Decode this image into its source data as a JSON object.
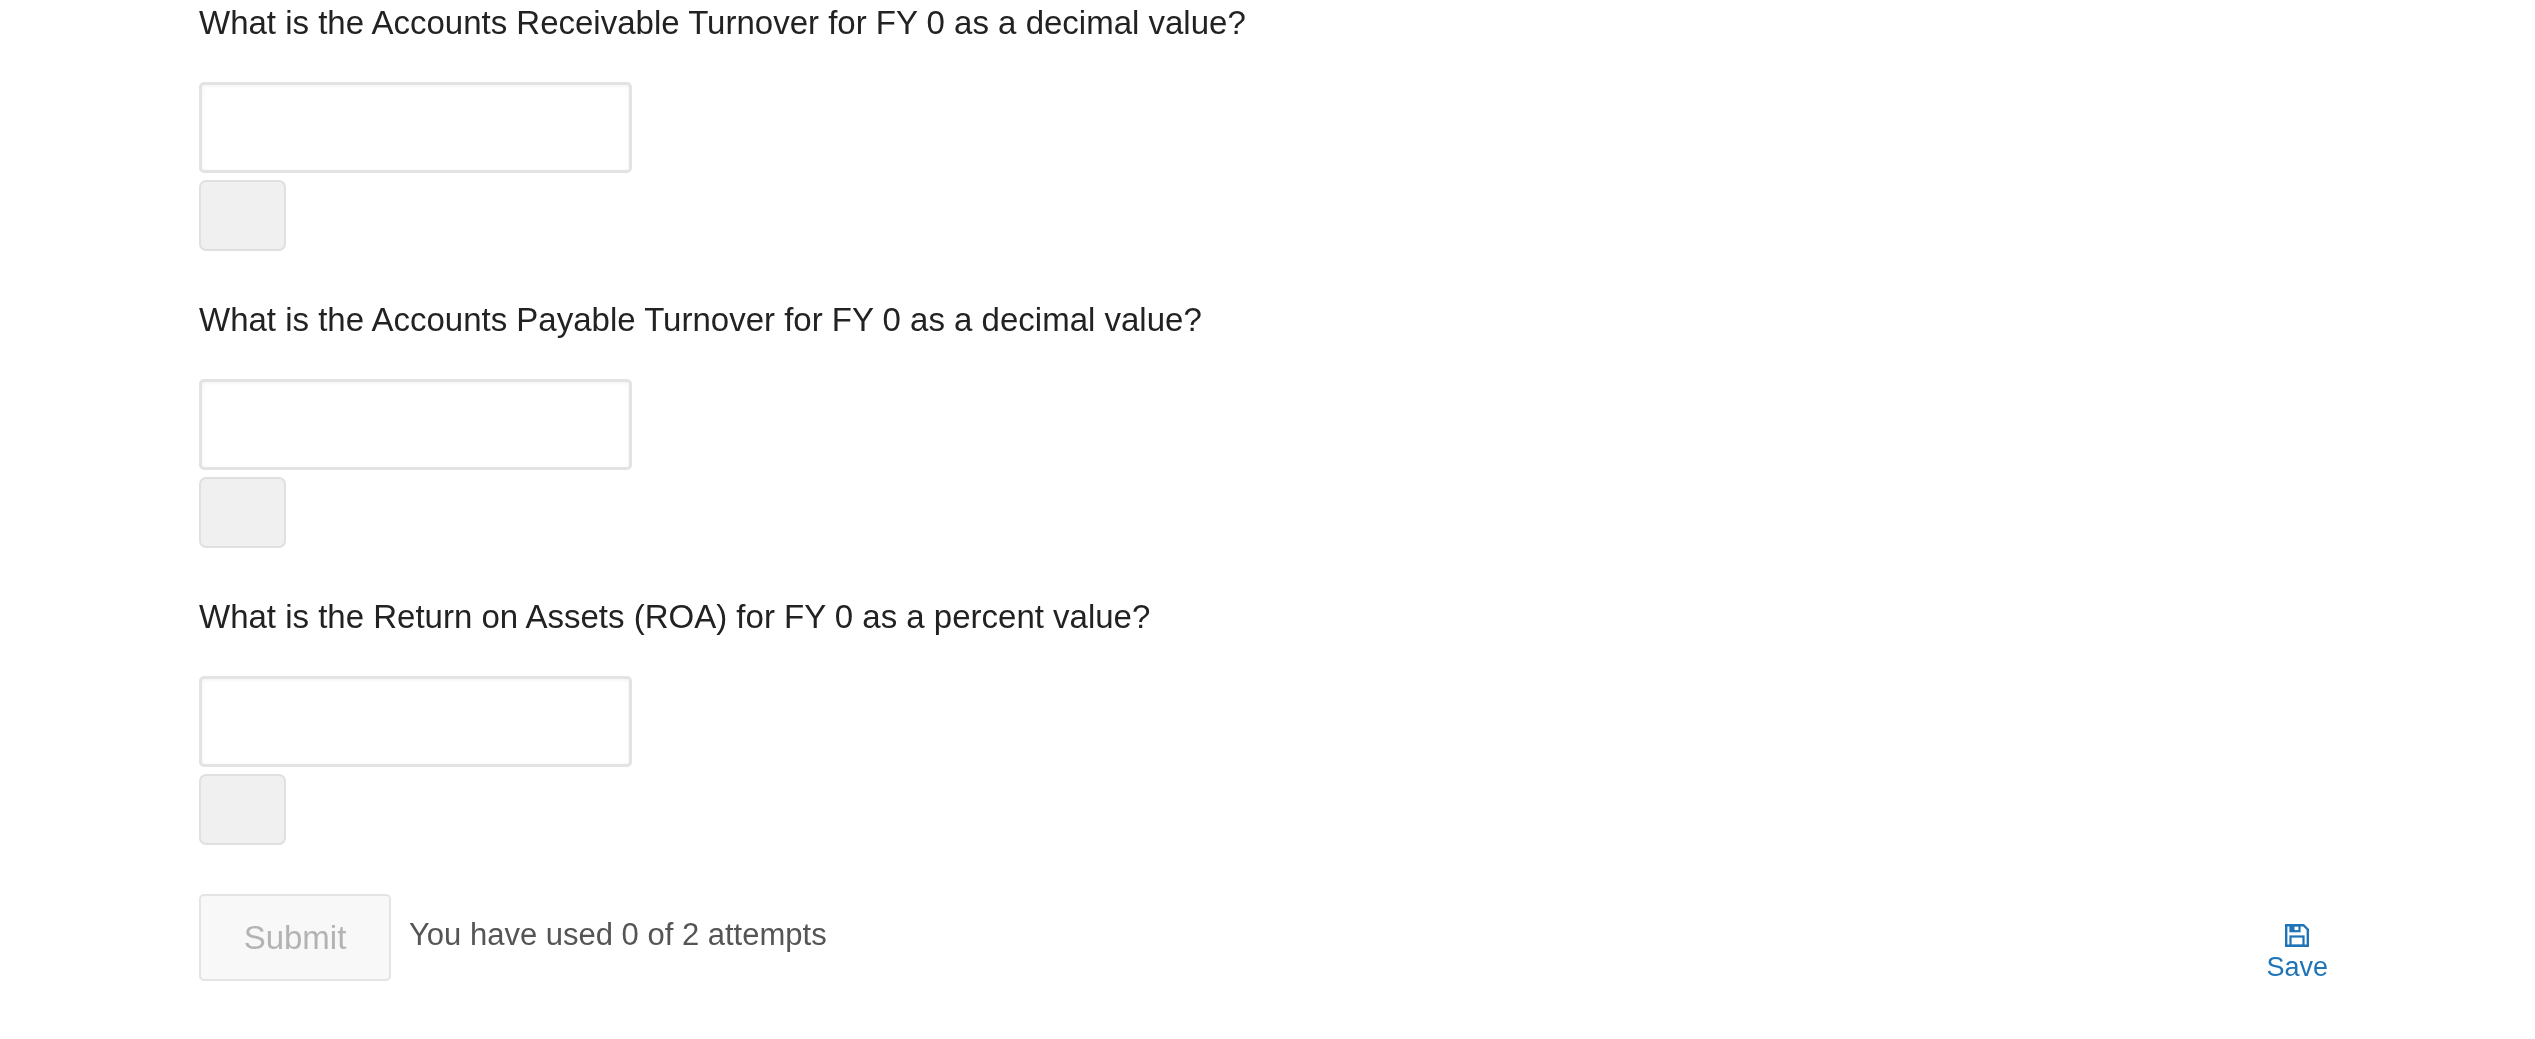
{
  "questions": [
    {
      "prompt": "What is the Accounts Receivable Turnover for FY 0 as a decimal value?"
    },
    {
      "prompt": "What is the Accounts Payable Turnover for FY 0 as a decimal value?"
    },
    {
      "prompt": "What is the Return on Assets (ROA) for FY 0 as a percent value?"
    }
  ],
  "submit": {
    "label": "Submit",
    "disabled": true
  },
  "attempts": "You have used 0 of 2 attempts",
  "save": {
    "label": "Save"
  }
}
